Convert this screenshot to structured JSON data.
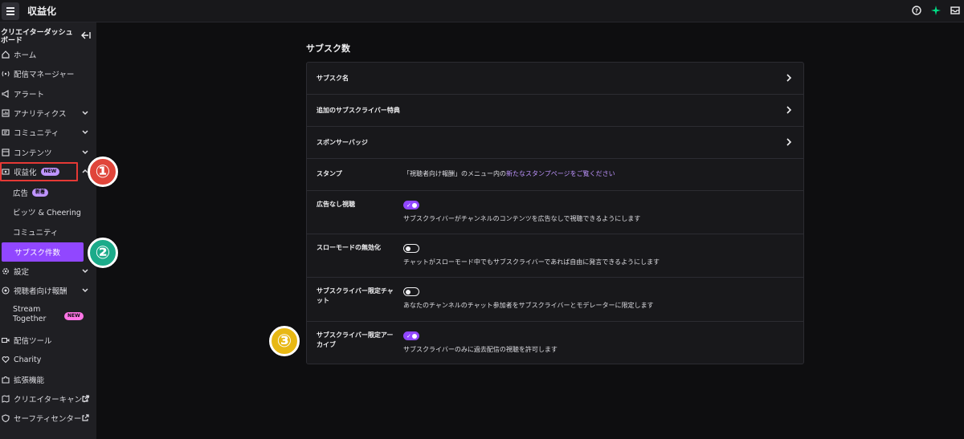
{
  "topbar": {
    "title": "収益化"
  },
  "sidebar": {
    "header": "クリエイターダッシュボード",
    "items": [
      {
        "label": "ホーム"
      },
      {
        "label": "配信マネージャー"
      },
      {
        "label": "アラート"
      },
      {
        "label": "アナリティクス"
      },
      {
        "label": "コミュニティ"
      },
      {
        "label": "コンテンツ"
      },
      {
        "label": "収益化",
        "badge": "NEW"
      },
      {
        "label": "広告",
        "badge": "新着"
      },
      {
        "label": "ビッツ & Cheering"
      },
      {
        "label": "コミュニティ"
      },
      {
        "label": "サブスク件数"
      },
      {
        "label": "設定"
      },
      {
        "label": "視聴者向け報酬"
      },
      {
        "label": "Stream Together",
        "badge": "NEW"
      },
      {
        "label": "配信ツール"
      },
      {
        "label": "Charity"
      },
      {
        "label": "拡張機能"
      },
      {
        "label": "クリエイターキャンプ"
      },
      {
        "label": "セーフティセンター"
      }
    ]
  },
  "markers": [
    "①",
    "②",
    "③"
  ],
  "main": {
    "title": "サブスク数",
    "rows": [
      {
        "label": "サブスク名"
      },
      {
        "label": "追加のサブスクライバー特典"
      },
      {
        "label": "スポンサーバッジ"
      },
      {
        "label": "スタンプ",
        "text_prefix": "「視聴者向け報酬」のメニュー内の",
        "link": "新たなスタンプページをご覧ください"
      },
      {
        "label": "広告なし視聴",
        "toggle": "on",
        "desc": "サブスクライバーがチャンネルのコンテンツを広告なしで視聴できるようにします"
      },
      {
        "label": "スローモードの無効化",
        "toggle": "off",
        "desc": "チャットがスローモード中でもサブスクライバーであれば自由に発言できるようにします"
      },
      {
        "label": "サブスクライバー限定チャット",
        "toggle": "off",
        "desc": "あなたのチャンネルのチャット参加者をサブスクライバーとモデレーターに限定します"
      },
      {
        "label": "サブスクライバー限定アーカイブ",
        "toggle": "on",
        "desc": "サブスクライバーのみに過去配信の視聴を許可します"
      }
    ]
  },
  "colors": {
    "accent": "#9147ff",
    "link": "#bf94ff",
    "marker1": "#e0453a",
    "marker2": "#1bab8a",
    "marker3": "#e8b814",
    "highlight": "#e53935"
  }
}
